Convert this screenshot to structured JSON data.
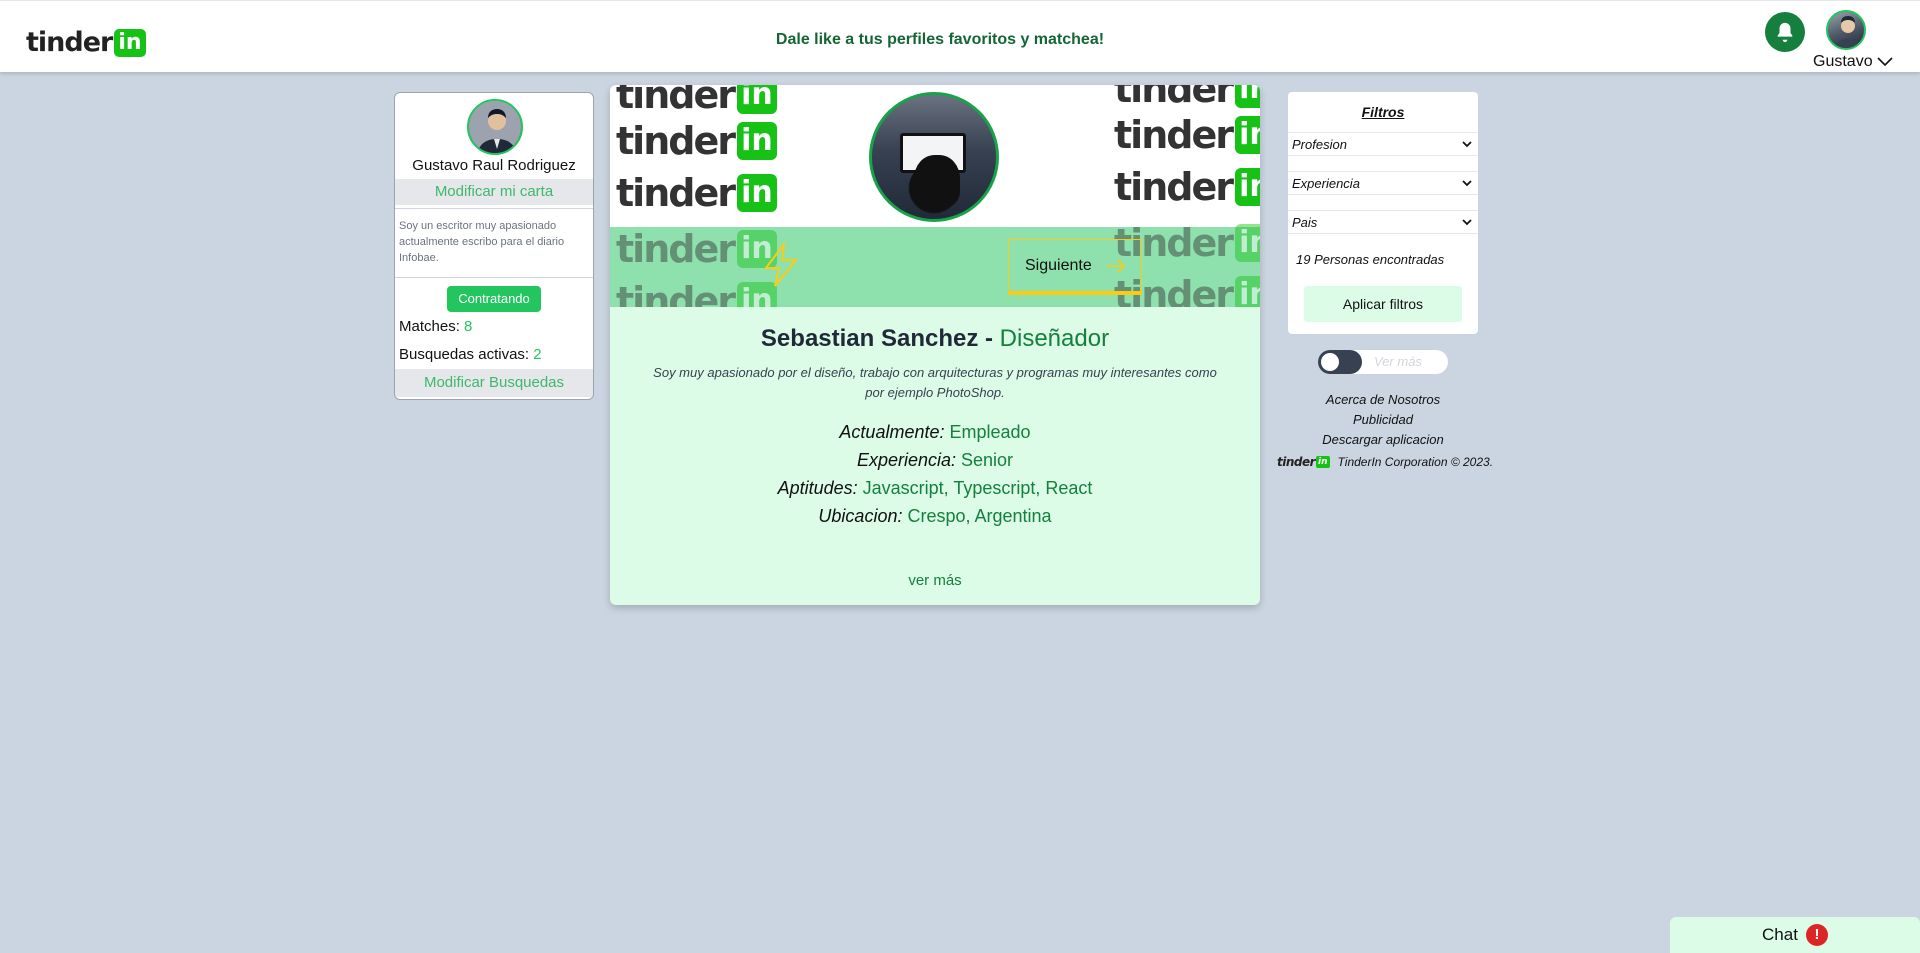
{
  "header": {
    "logo_text": "tinder",
    "logo_badge": "in",
    "tagline": "Dale like a tus perfiles favoritos y matchea!",
    "user_name": "Gustavo"
  },
  "profile": {
    "name": "Gustavo Raul Rodriguez",
    "modify_card": "Modificar mi carta",
    "bio": "Soy un escritor muy apasionado actualmente escribo para el diario Infobae.",
    "status": "Contratando",
    "matches_label": "Matches:",
    "matches_value": "8",
    "searches_label": "Busquedas activas:",
    "searches_value": "2",
    "modify_searches": "Modificar Busquedas"
  },
  "card": {
    "next_label": "Siguiente",
    "name": "Sebastian Sanchez -",
    "role": "Diseñador",
    "description": "Soy muy apasionado por el diseño, trabajo con arquitecturas y programas muy interesantes como por ejemplo PhotoShop.",
    "details": [
      {
        "label": "Actualmente:",
        "value": "Empleado"
      },
      {
        "label": "Experiencia:",
        "value": "Senior"
      },
      {
        "label": "Aptitudes:",
        "value": "Javascript, Typescript, React"
      },
      {
        "label": "Ubicacion:",
        "value": "Crespo, Argentina"
      }
    ],
    "see_more": "ver más"
  },
  "filters": {
    "title": "Filtros",
    "profession": "Profesion",
    "experience": "Experiencia",
    "country": "Pais",
    "results": "19 Personas encontradas",
    "apply": "Aplicar filtros"
  },
  "toggle": {
    "label": "Ver más",
    "on": false
  },
  "footer": {
    "about": "Acerca de Nosotros",
    "ads": "Publicidad",
    "download": "Descargar aplicacion",
    "copyright": "TinderIn Corporation © 2023."
  },
  "chat": {
    "label": "Chat",
    "badge": "!"
  },
  "colors": {
    "brand_green": "#16c216",
    "accent_green": "#22c55e",
    "card_bg": "#dcfce7",
    "page_bg": "#cbd5e1"
  }
}
